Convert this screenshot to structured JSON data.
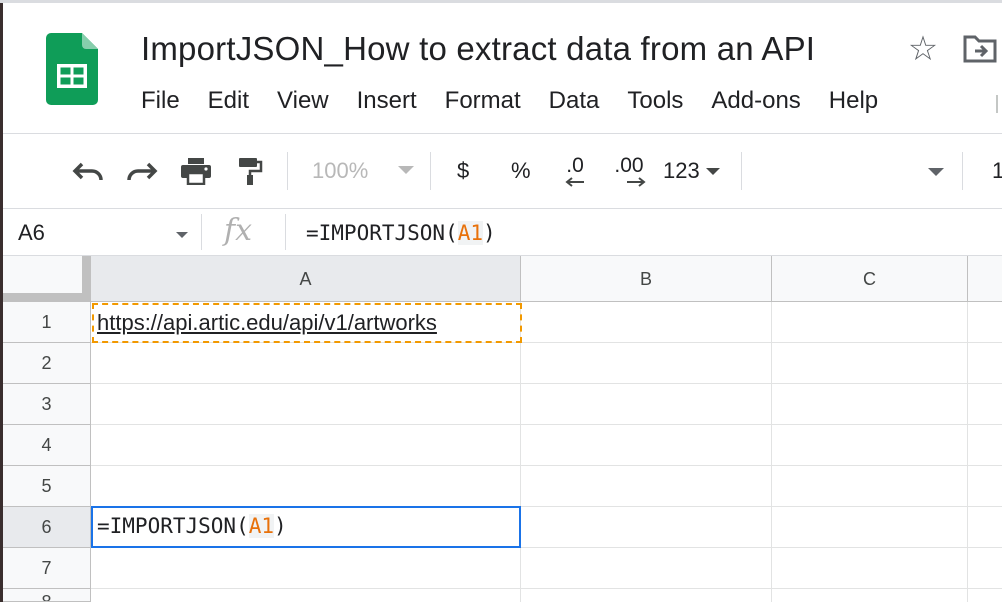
{
  "app": {
    "doc_title": "ImportJSON_How to extract data from an API",
    "brand_color": "#0f9d58",
    "menu": [
      "File",
      "Edit",
      "View",
      "Insert",
      "Format",
      "Data",
      "Tools",
      "Add-ons",
      "Help"
    ]
  },
  "toolbar": {
    "undo_icon": "undo-icon",
    "redo_icon": "redo-icon",
    "print_icon": "print-icon",
    "paint_format_icon": "paint-format-icon",
    "zoom": "100%",
    "currency": "$",
    "percent": "%",
    "decrease_decimal": ".0",
    "increase_decimal": ".00",
    "more_formats": "123",
    "font_size_partial": "1"
  },
  "formula_bar": {
    "name_box": "A6",
    "fx_label": "fx",
    "formula_prefix": "=IMPORTJSON(",
    "formula_ref": "A1",
    "formula_suffix": ")"
  },
  "grid": {
    "columns": [
      "A",
      "B",
      "C"
    ],
    "rows": [
      "1",
      "2",
      "3",
      "4",
      "5",
      "6",
      "7",
      "8"
    ],
    "cells": {
      "A1": "https://api.artic.edu/api/v1/artworks"
    },
    "active_cell": "A6",
    "active_edit": {
      "prefix": "=IMPORTJSON(",
      "ref": "A1",
      "suffix": ")"
    },
    "selection_color": "#1a73e8",
    "reference_color": "#e8710a",
    "copy_border_color": "#f29900"
  }
}
